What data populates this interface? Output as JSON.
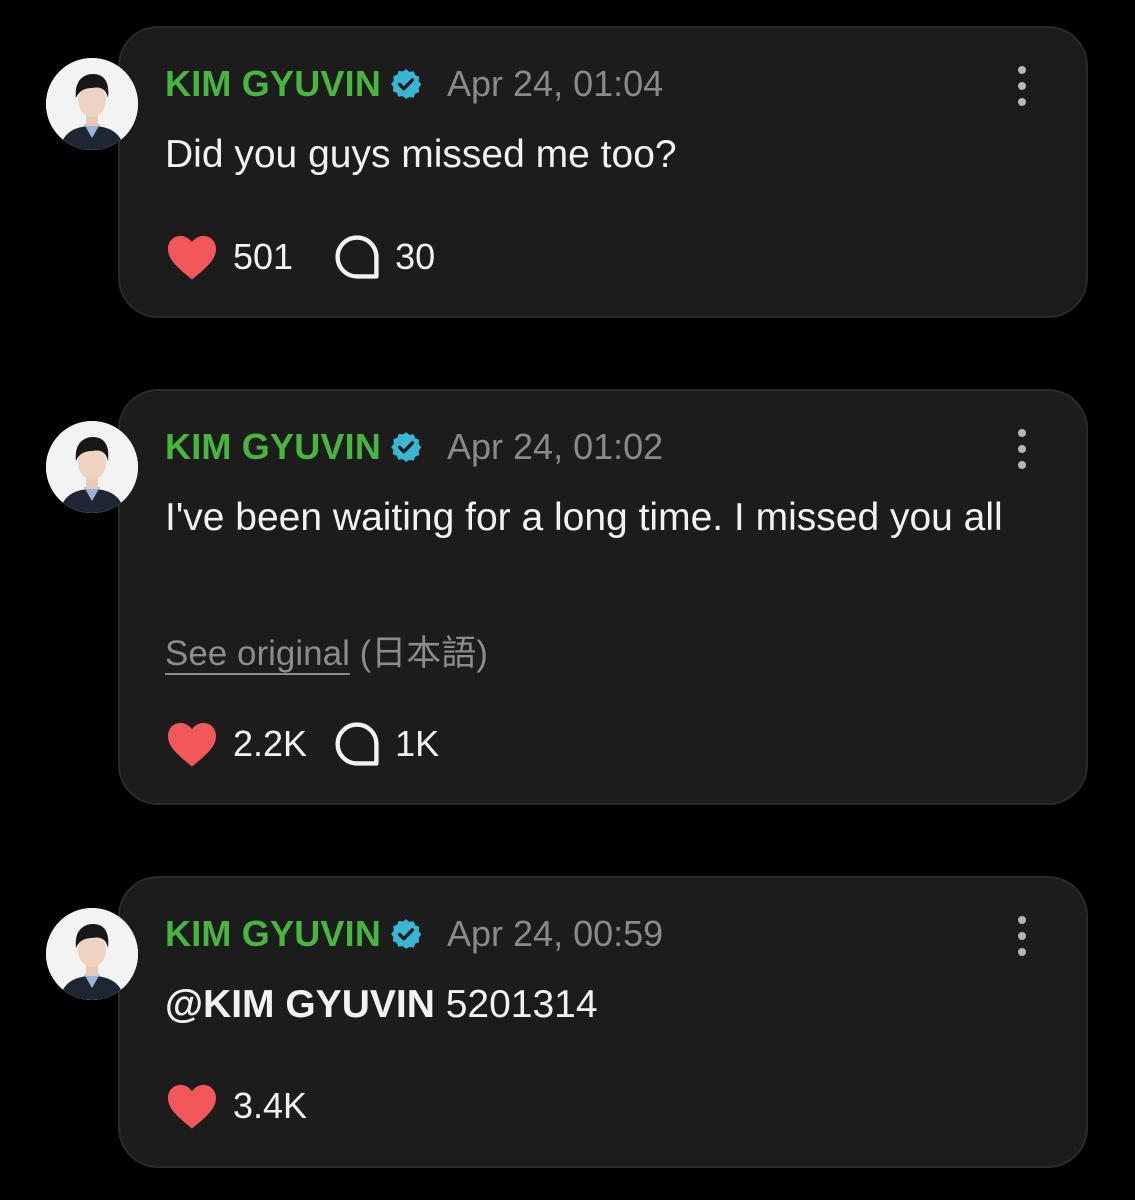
{
  "colors": {
    "background": "#000000",
    "card": "#1c1c1c",
    "author": "#48b53e",
    "verified": "#39b6d3",
    "heart": "#f0585a",
    "timestamp": "#8a8a8a"
  },
  "posts": [
    {
      "author": "KIM GYUVIN",
      "verified_icon": "verified-badge-icon",
      "time": "Apr 24, 01:04",
      "text": "Did you guys missed me too?",
      "likes": "501",
      "comments": "30"
    },
    {
      "author": "KIM GYUVIN",
      "verified_icon": "verified-badge-icon",
      "time": "Apr 24, 01:02",
      "text": "I've been waiting for a long time. I missed you all",
      "see_original": "See original",
      "original_language": "(日本語)",
      "likes": "2.2K",
      "comments": "1K"
    },
    {
      "author": "KIM GYUVIN",
      "verified_icon": "verified-badge-icon",
      "time": "Apr 24, 00:59",
      "mention": "@KIM GYUVIN",
      "text": "5201314",
      "likes": "3.4K"
    }
  ]
}
